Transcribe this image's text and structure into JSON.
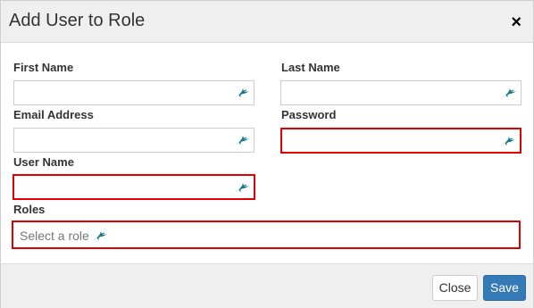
{
  "dialog": {
    "title": "Add User to Role",
    "close_glyph": "×"
  },
  "form": {
    "first_name": {
      "label": "First Name",
      "value": "",
      "error": false
    },
    "last_name": {
      "label": "Last Name",
      "value": "",
      "error": false
    },
    "email": {
      "label": "Email Address",
      "value": "",
      "error": false
    },
    "password": {
      "label": "Password",
      "value": "",
      "error": true
    },
    "user_name": {
      "label": "User Name",
      "value": "",
      "error": true
    },
    "roles": {
      "label": "Roles",
      "placeholder": "Select a role",
      "error": true
    }
  },
  "footer": {
    "close_label": "Close",
    "save_label": "Save"
  },
  "icons": {
    "field_icon": "password-manager-autofill-icon"
  },
  "colors": {
    "error_border": "#e00000",
    "primary": "#337ab7",
    "icon": "#1b7a8a"
  }
}
